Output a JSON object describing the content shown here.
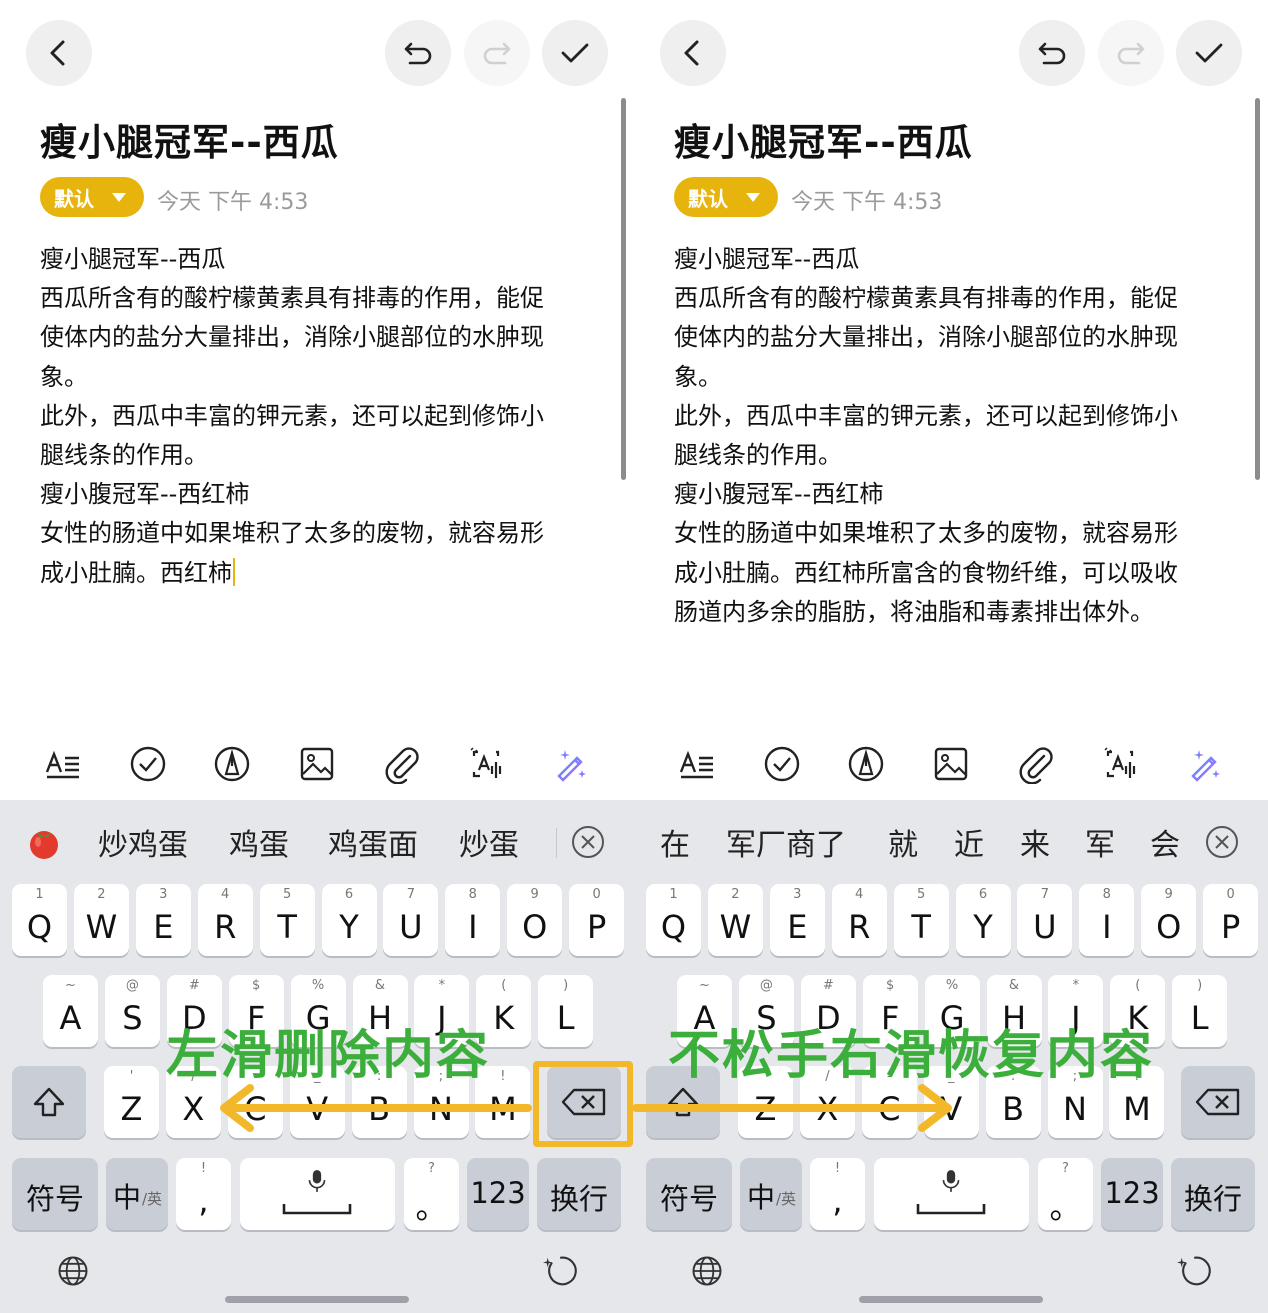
{
  "left": {
    "title": "瘦小腿冠军--西瓜",
    "category": "默认",
    "date": "今天 下午 4:53",
    "body_lines": [
      "瘦小腿冠军--西瓜",
      "西瓜所含有的酸柠檬黄素具有排毒的作用，能促",
      "使体内的盐分大量排出，消除小腿部位的水肿现",
      "象。",
      "此外，西瓜中丰富的钾元素，还可以起到修饰小",
      "腿线条的作用。",
      "瘦小腹冠军--西红柿",
      "女性的肠道中如果堆积了太多的废物，就容易形",
      "成小肚腩。西红柿"
    ],
    "candidates": [
      "炒鸡蛋",
      "鸡蛋",
      "鸡蛋面",
      "炒蛋"
    ],
    "overlay_label": "左滑删除内容"
  },
  "right": {
    "title": "瘦小腿冠军--西瓜",
    "category": "默认",
    "date": "今天 下午 4:53",
    "body_lines": [
      "瘦小腿冠军--西瓜",
      "西瓜所含有的酸柠檬黄素具有排毒的作用，能促",
      "使体内的盐分大量排出，消除小腿部位的水肿现",
      "象。",
      "此外，西瓜中丰富的钾元素，还可以起到修饰小",
      "腿线条的作用。",
      "瘦小腹冠军--西红柿",
      "女性的肠道中如果堆积了太多的废物，就容易形",
      "成小肚腩。西红柿所富含的食物纤维，可以吸收",
      "肠道内多余的脂肪，将油脂和毒素排出体外。"
    ],
    "candidates": [
      "在",
      "军厂商了",
      "就",
      "近",
      "来",
      "军",
      "会"
    ],
    "overlay_label": "不松手右滑恢复内容"
  },
  "keyboard": {
    "row1": [
      {
        "sub": "1",
        "key": "Q"
      },
      {
        "sub": "2",
        "key": "W"
      },
      {
        "sub": "3",
        "key": "E"
      },
      {
        "sub": "4",
        "key": "R"
      },
      {
        "sub": "5",
        "key": "T"
      },
      {
        "sub": "6",
        "key": "Y"
      },
      {
        "sub": "7",
        "key": "U"
      },
      {
        "sub": "8",
        "key": "I"
      },
      {
        "sub": "9",
        "key": "O"
      },
      {
        "sub": "0",
        "key": "P"
      }
    ],
    "row2": [
      {
        "sub": "~",
        "key": "A"
      },
      {
        "sub": "@",
        "key": "S"
      },
      {
        "sub": "#",
        "key": "D"
      },
      {
        "sub": "$",
        "key": "F"
      },
      {
        "sub": "%",
        "key": "G"
      },
      {
        "sub": "&",
        "key": "H"
      },
      {
        "sub": "*",
        "key": "J"
      },
      {
        "sub": "(",
        "key": "K"
      },
      {
        "sub": ")",
        "key": "L"
      }
    ],
    "row3": [
      {
        "sub": "'",
        "key": "Z"
      },
      {
        "sub": "/",
        "key": "X"
      },
      {
        "sub": "-",
        "key": "C"
      },
      {
        "sub": "_",
        "key": "V"
      },
      {
        "sub": ":",
        "key": "B"
      },
      {
        "sub": ";",
        "key": "N"
      },
      {
        "sub": "!",
        "key": "M"
      }
    ],
    "symbols_label": "符号",
    "lang_main": "中",
    "lang_sub": "/英",
    "comma_sub": "!",
    "comma": ",",
    "period_sub": "?",
    "period": "。",
    "num_label": "123",
    "enter_label": "换行"
  },
  "colors": {
    "accent": "#e6b40c",
    "overlay_text": "#3cae3c",
    "arrow": "#f2b82a",
    "keyboard_bg": "#e5e7eb"
  },
  "icons": {
    "header": [
      "back-arrow-icon",
      "undo-icon",
      "redo-icon",
      "check-icon"
    ],
    "toolbar": [
      "text-format-icon",
      "checklist-icon",
      "pen-icon",
      "image-icon",
      "attachment-icon",
      "voice-text-icon",
      "ai-magic-wand-icon"
    ],
    "keyboard": [
      "tomato-icon",
      "close-candidates-icon",
      "shift-icon",
      "backspace-icon",
      "microphone-icon",
      "globe-icon",
      "rotate-icon"
    ]
  }
}
